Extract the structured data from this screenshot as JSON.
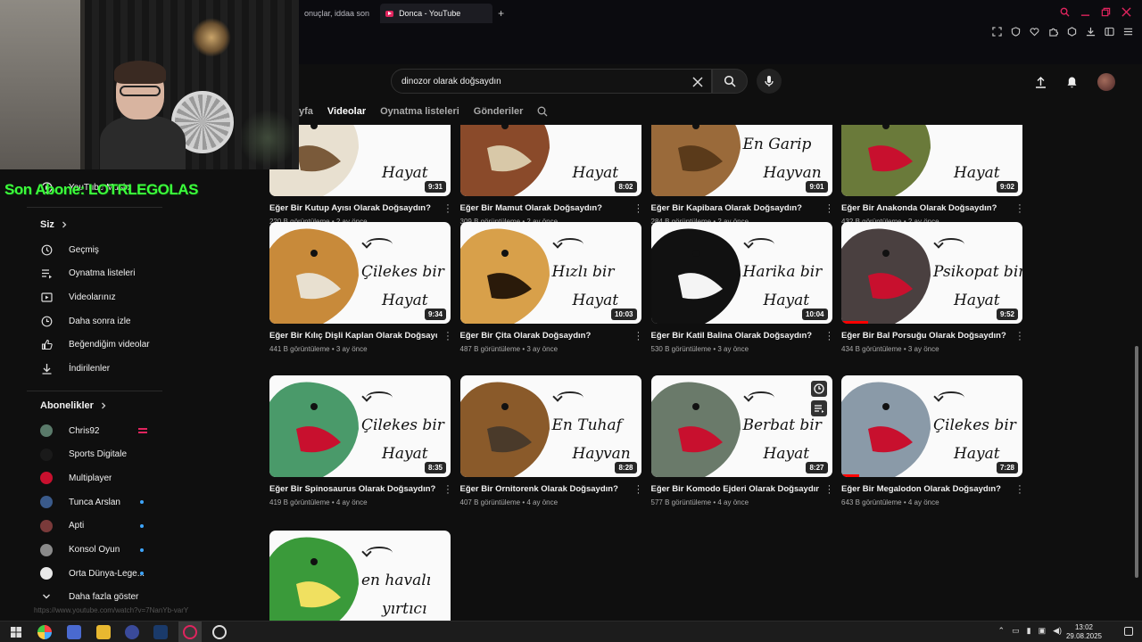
{
  "browser": {
    "tabs": [
      {
        "label": "onuçlar, iddaa son"
      },
      {
        "label": "Donca - YouTube",
        "active": true
      }
    ],
    "new_tab": "+"
  },
  "search": {
    "query": "dinozor olarak doğsaydın"
  },
  "channel_tabs": [
    {
      "label": "yfa"
    },
    {
      "label": "Videolar",
      "active": true
    },
    {
      "label": "Oynatma listeleri"
    },
    {
      "label": "Gönderiler"
    }
  ],
  "overlay": {
    "son_abone": "Son Abone: LOTRLEGOLAS"
  },
  "sidebar": {
    "youtube_music": "YouTube Music",
    "siz": "Siz",
    "items": [
      {
        "label": "Geçmiş",
        "icon": "history-icon"
      },
      {
        "label": "Oynatma listeleri",
        "icon": "playlist-icon"
      },
      {
        "label": "Videolarınız",
        "icon": "your-videos-icon"
      },
      {
        "label": "Daha sonra izle",
        "icon": "watch-later-icon"
      },
      {
        "label": "Beğendiğim videolar",
        "icon": "like-icon"
      },
      {
        "label": "İndirilenler",
        "icon": "download-icon"
      }
    ],
    "abonelikler": "Abonelikler",
    "subs": [
      {
        "label": "Chris92",
        "color": "#5a7a6a",
        "indicator": "live"
      },
      {
        "label": "Sports Digitale",
        "color": "#1a1a1a",
        "indicator": "none"
      },
      {
        "label": "Multiplayer",
        "color": "#c8102e",
        "indicator": "none"
      },
      {
        "label": "Tunca Arslan",
        "color": "#3a5a8a",
        "indicator": "dot"
      },
      {
        "label": "Apti",
        "color": "#7a3a3a",
        "indicator": "dot"
      },
      {
        "label": "Konsol Oyun",
        "color": "#8a8a8a",
        "indicator": "dot"
      },
      {
        "label": "Orta Dünya-Lege...",
        "color": "#e8e8e8",
        "indicator": "dot"
      }
    ],
    "more": "Daha fazla göster",
    "status_url": "https://www.youtube.com/watch?v=7NanYb-varY"
  },
  "videos": [
    {
      "title": "Eğer Bir Kutup Ayısı Olarak Doğsaydın?",
      "meta": "220 B görüntüleme • 2 ay önce",
      "duration": "9:31",
      "line1": "",
      "line2": "Hayat",
      "art": "#e8e0d0",
      "art2": "#7a5a3a",
      "progress": 0
    },
    {
      "title": "Eğer Bir Mamut Olarak Doğsaydın?",
      "meta": "309 B görüntüleme • 2 ay önce",
      "duration": "8:02",
      "line1": "",
      "line2": "Hayat",
      "art": "#8a4a2a",
      "art2": "#d8c8a8",
      "progress": 0
    },
    {
      "title": "Eğer Bir Kapibara Olarak Doğsaydın?",
      "meta": "284 B görüntüleme • 2 ay önce",
      "duration": "9:01",
      "line1": "En Garip",
      "line2": "Hayvan",
      "art": "#9a6a3a",
      "art2": "#5a3a1a",
      "progress": 0
    },
    {
      "title": "Eğer Bir Anakonda Olarak Doğsaydın?",
      "meta": "432 B görüntüleme • 2 ay önce",
      "duration": "9:02",
      "line1": "",
      "line2": "Hayat",
      "art": "#6a7a3a",
      "art2": "#c8102e",
      "progress": 0
    },
    {
      "title": "Eğer Bir Kılıç Dişli Kaplan Olarak Doğsaydın?",
      "meta": "441 B görüntüleme • 3 ay önce",
      "duration": "9:34",
      "line1": "Çilekes bir",
      "line2": "Hayat",
      "art": "#c88a3a",
      "art2": "#e8e0d0",
      "progress": 0
    },
    {
      "title": "Eğer Bir Çita Olarak Doğsaydın?",
      "meta": "487 B görüntüleme • 3 ay önce",
      "duration": "10:03",
      "line1": "Hızlı bir",
      "line2": "Hayat",
      "art": "#d8a04a",
      "art2": "#2a1a0a",
      "progress": 0
    },
    {
      "title": "Eğer Bir Katil Balina Olarak Doğsaydın?",
      "meta": "530 B görüntüleme • 3 ay önce",
      "duration": "10:04",
      "line1": "Harika bir",
      "line2": "Hayat",
      "art": "#111111",
      "art2": "#f4f4f4",
      "progress": 0
    },
    {
      "title": "Eğer Bir Bal Porsuğu Olarak Doğsaydın?",
      "meta": "434 B görüntüleme • 3 ay önce",
      "duration": "9:52",
      "line1": "Psikopat bir",
      "line2": "Hayat",
      "art": "#4a4040",
      "art2": "#c8102e",
      "progress": 0.15
    },
    {
      "title": "Eğer Bir Spinosaurus Olarak Doğsaydın?",
      "meta": "419 B görüntüleme • 4 ay önce",
      "duration": "8:35",
      "line1": "Çilekes bir",
      "line2": "Hayat",
      "art": "#4a9a6a",
      "art2": "#c8102e",
      "progress": 0
    },
    {
      "title": "Eğer Bir Ornitorenk Olarak Doğsaydın?",
      "meta": "407 B görüntüleme • 4 ay önce",
      "duration": "8:28",
      "line1": "En Tuhaf",
      "line2": "Hayvan",
      "art": "#8a5a2a",
      "art2": "#4a3a2a",
      "progress": 0
    },
    {
      "title": "Eğer Bir Komodo Ejderi Olarak Doğsaydın?",
      "meta": "577 B görüntüleme • 4 ay önce",
      "duration": "8:27",
      "line1": "Berbat bir",
      "line2": "Hayat",
      "art": "#6a7a6a",
      "art2": "#c8102e",
      "progress": 0,
      "overlay_icons": true
    },
    {
      "title": "Eğer Bir Megalodon Olarak Doğsaydın?",
      "meta": "643 B görüntüleme • 4 ay önce",
      "duration": "7:28",
      "line1": "Çilekes bir",
      "line2": "Hayat",
      "art": "#8a9aa8",
      "art2": "#c8102e",
      "progress": 0.1
    },
    {
      "title": "",
      "meta": "",
      "duration": "",
      "line1": "en havalı",
      "line2": "yırtıcı",
      "art": "#3a9a3a",
      "art2": "#f0e060",
      "progress": 0
    }
  ],
  "taskbar": {
    "time": "13:02",
    "date": "29.08.2025"
  }
}
